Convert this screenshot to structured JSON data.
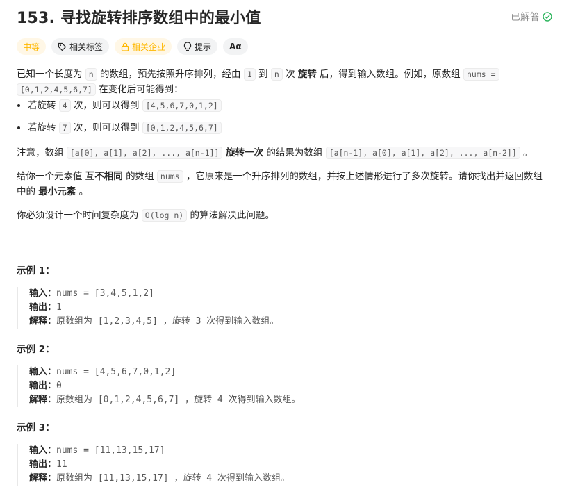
{
  "problem": {
    "title": "153. 寻找旋转排序数组中的最小值",
    "status": "已解答"
  },
  "tags": {
    "difficulty": "中等",
    "topics": "相关标签",
    "companies": "相关企业",
    "hint": "提示",
    "font_icon": "Aα"
  },
  "description": {
    "p1_a": "已知一个长度为 ",
    "p1_n": "n",
    "p1_b": " 的数组，预先按照升序排列，经由 ",
    "p1_one": "1",
    "p1_c": " 到 ",
    "p1_n2": "n",
    "p1_d": " 次 ",
    "p1_bold": "旋转",
    "p1_e": " 后，得到输入数组。例如，原数组 ",
    "p1_nums": "nums =",
    "p1_arr": "[0,1,2,4,5,6,7]",
    "p1_f": " 在变化后可能得到：",
    "b1_a": "若旋转 ",
    "b1_k": "4",
    "b1_b": " 次，则可以得到 ",
    "b1_arr": "[4,5,6,7,0,1,2]",
    "b2_a": "若旋转 ",
    "b2_k": "7",
    "b2_b": " 次，则可以得到 ",
    "b2_arr": "[0,1,2,4,5,6,7]",
    "p2_a": "注意，数组 ",
    "p2_arr1": "[a[0], a[1], a[2], ..., a[n-1]]",
    "p2_bold": " 旋转一次",
    "p2_b": " 的结果为数组 ",
    "p2_arr2": "[a[n-1], a[0], a[1], a[2], ..., a[n-2]]",
    "p2_c": " 。",
    "p3_a": "给你一个元素值 ",
    "p3_bold1": "互不相同",
    "p3_b": " 的数组 ",
    "p3_nums": "nums",
    "p3_c": " ，它原来是一个升序排列的数组，并按上述情形进行了多次旋转。请你找出并返回数组中的 ",
    "p3_bold2": "最小元素",
    "p3_d": " 。",
    "p4_a": "你必须设计一个时间复杂度为 ",
    "p4_code": "O(log n)",
    "p4_b": " 的算法解决此问题。"
  },
  "examples": [
    {
      "title": "示例 1：",
      "input_label": "输入：",
      "input": "nums = [3,4,5,1,2]",
      "output_label": "输出：",
      "output": "1",
      "explain_label": "解释：",
      "explain_a": "原数组为",
      "explain_arr": " [1,2,3,4,5] ",
      "explain_b": "，旋转",
      "explain_k": " 3 ",
      "explain_c": "次得到输入数组。"
    },
    {
      "title": "示例 2：",
      "input_label": "输入：",
      "input": "nums = [4,5,6,7,0,1,2]",
      "output_label": "输出：",
      "output": "0",
      "explain_label": "解释：",
      "explain_a": "原数组为",
      "explain_arr": " [0,1,2,4,5,6,7] ",
      "explain_b": "，旋转",
      "explain_k": " 4 ",
      "explain_c": "次得到输入数组。"
    },
    {
      "title": "示例 3：",
      "input_label": "输入：",
      "input": "nums = [11,13,15,17]",
      "output_label": "输出：",
      "output": "11",
      "explain_label": "解释：",
      "explain_a": "原数组为",
      "explain_arr": " [11,13,15,17] ",
      "explain_b": "，旋转",
      "explain_k": " 4 ",
      "explain_c": "次得到输入数组。"
    }
  ],
  "colors": {
    "difficulty_medium": "#ffb800",
    "solved_check": "#2db55d",
    "text_primary": "#262626",
    "text_secondary": "#595959"
  },
  "icons": {
    "solved": "check-circle-icon",
    "topics": "tag-icon",
    "companies": "lock-icon",
    "hint": "lightbulb-icon"
  }
}
